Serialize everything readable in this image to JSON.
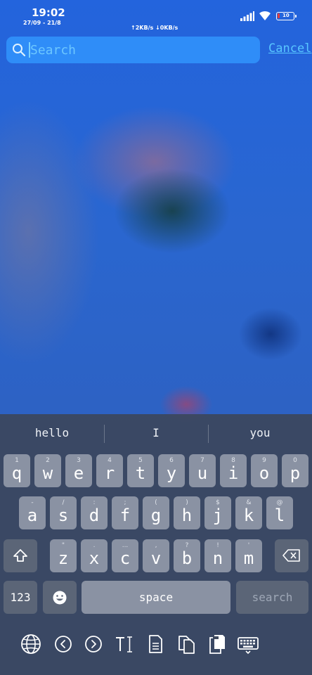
{
  "status_bar": {
    "time": "19:02",
    "date": "27/09 - 21/8",
    "network_speed": "↑2KB/s ↓0KB/s",
    "battery": "10",
    "battery_color": "#e23b3b",
    "icons": [
      "signal-icon",
      "wifi-icon",
      "battery-icon"
    ]
  },
  "search": {
    "placeholder": "Search",
    "value": "",
    "cancel_label": "Cancel",
    "accent": "#2f8df8"
  },
  "keyboard": {
    "suggestions": [
      "hello",
      "I",
      "you"
    ],
    "row1": [
      {
        "hint": "1",
        "ch": "q"
      },
      {
        "hint": "2",
        "ch": "w"
      },
      {
        "hint": "3",
        "ch": "e"
      },
      {
        "hint": "4",
        "ch": "r"
      },
      {
        "hint": "5",
        "ch": "t"
      },
      {
        "hint": "6",
        "ch": "y"
      },
      {
        "hint": "7",
        "ch": "u"
      },
      {
        "hint": "8",
        "ch": "i"
      },
      {
        "hint": "9",
        "ch": "o"
      },
      {
        "hint": "0",
        "ch": "p"
      }
    ],
    "row2": [
      {
        "hint": "-",
        "ch": "a"
      },
      {
        "hint": "/",
        "ch": "s"
      },
      {
        "hint": ":",
        "ch": "d"
      },
      {
        "hint": ";",
        "ch": "f"
      },
      {
        "hint": "(",
        "ch": "g"
      },
      {
        "hint": ")",
        "ch": "h"
      },
      {
        "hint": "$",
        "ch": "j"
      },
      {
        "hint": "&",
        "ch": "k"
      },
      {
        "hint": "@",
        "ch": "l"
      }
    ],
    "row3": [
      {
        "hint": "\"",
        "ch": "z"
      },
      {
        "hint": ".",
        "ch": "x"
      },
      {
        "hint": "...",
        "ch": "c"
      },
      {
        "hint": ",",
        "ch": "v"
      },
      {
        "hint": "?",
        "ch": "b"
      },
      {
        "hint": "!",
        "ch": "n"
      },
      {
        "hint": "'",
        "ch": "m"
      }
    ],
    "numbers_label": "123",
    "space_label": "space",
    "action_label": "search",
    "toolbar": [
      "globe-icon",
      "cursor-left-icon",
      "cursor-right-icon",
      "text-select-icon",
      "document-icon",
      "copy-icon",
      "paste-icon",
      "keyboard-icon"
    ]
  }
}
